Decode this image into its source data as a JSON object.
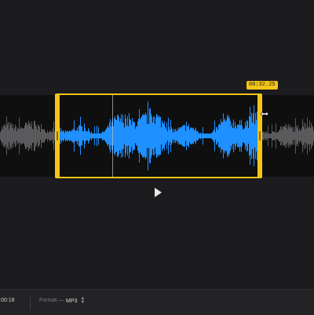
{
  "selection": {
    "end_time_label": "00:32.25"
  },
  "footer": {
    "timecode": "00:18",
    "format_label": "Format —",
    "format_value": "MP3",
    "format_chevron_up": "▲",
    "format_chevron_down": "▼"
  },
  "colors": {
    "accent": "#f5c518",
    "selected_waveform": "#1e90ff",
    "unselected_waveform": "#5a5a5c",
    "background": "#1c1c1e",
    "track": "#0f0f10"
  },
  "icons": {
    "play": "play-icon",
    "cursor": "resize-cursor-icon"
  }
}
